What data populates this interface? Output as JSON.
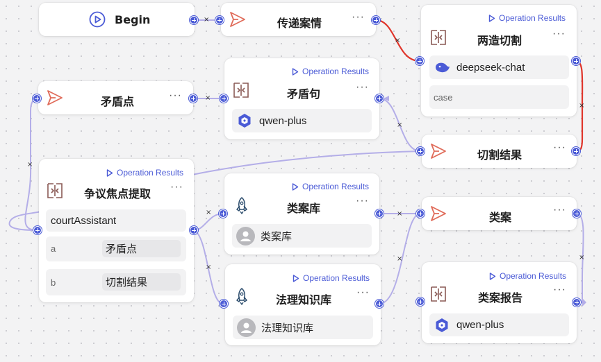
{
  "op_label": "Operation Results",
  "more": "···",
  "remove": "×",
  "colors": {
    "accent": "#4b5bd6",
    "edge": "#b4aee8",
    "edge_active": "#e0352b",
    "llm_icon": "#8a5a55",
    "send_icon": "#e06c5a"
  },
  "nodes": {
    "begin": {
      "title": "Begin"
    },
    "chuandi": {
      "title": "传递案情"
    },
    "liangzao": {
      "title": "两造切割",
      "model": "deepseek-chat",
      "input": "case"
    },
    "maodunju": {
      "title": "矛盾句",
      "model": "qwen-plus"
    },
    "maodundian": {
      "title": "矛盾点"
    },
    "qiegejieguo": {
      "title": "切割结果"
    },
    "zhengyi": {
      "title": "争议焦点提取",
      "agent": "courtAssistant",
      "params": [
        {
          "key": "a",
          "value": "矛盾点"
        },
        {
          "key": "b",
          "value": "切割结果"
        }
      ]
    },
    "leianku": {
      "title": "类案库",
      "kb": "类案库"
    },
    "leian": {
      "title": "类案"
    },
    "fali": {
      "title": "法理知识库",
      "kb": "法理知识库"
    },
    "leianbaogao": {
      "title": "类案报告",
      "model": "qwen-plus"
    }
  }
}
